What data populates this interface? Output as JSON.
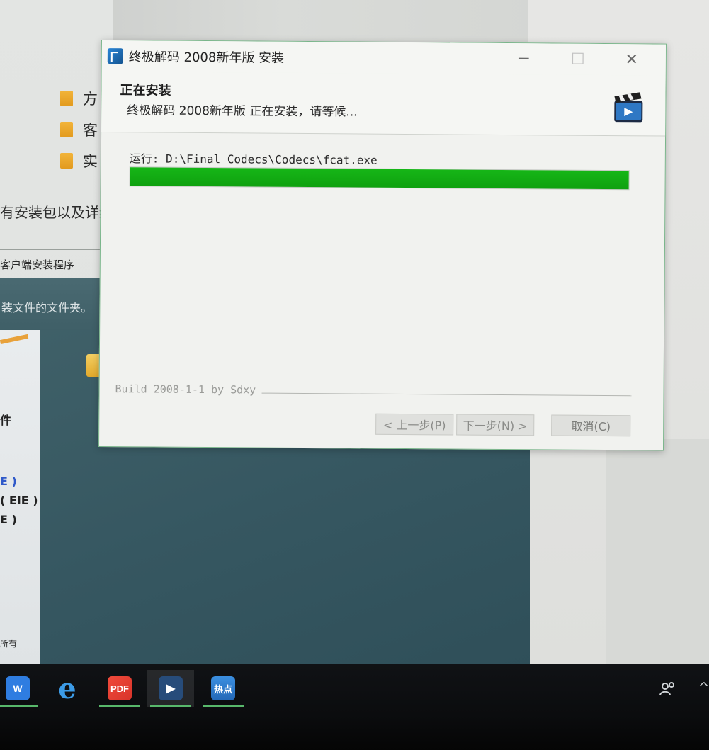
{
  "background": {
    "folders": [
      "方",
      "客",
      "实"
    ],
    "text_package": "有安装包以及详细",
    "text_client": "客户端安装程序",
    "text_folder": "装文件的文件夹。",
    "marks_blue": [
      "E )",
      "( EIE )"
    ],
    "marks_dark": [
      "E )",
      "件",
      "所有"
    ]
  },
  "dialog": {
    "title": "终极解码 2008新年版 安装",
    "minimize": "─",
    "maximize": "☐",
    "close": "✕",
    "header_title": "正在安装",
    "header_subtitle": "终极解码 2008新年版 正在安装，请等候...",
    "status_text": "运行: D:\\Final Codecs\\Codecs\\fcat.exe",
    "progress_fraction": 1.0,
    "build_text": "Build 2008-1-1 by Sdxy",
    "buttons": {
      "back": "< 上一步(P)",
      "next": "下一步(N) >",
      "cancel": "取消(C)"
    }
  },
  "taskbar": {
    "items": [
      {
        "name": "wps-writer",
        "label": "W"
      },
      {
        "name": "internet-explorer",
        "label": "e"
      },
      {
        "name": "pdf-reader",
        "label": "PDF"
      },
      {
        "name": "codec-installer",
        "label": "▶"
      },
      {
        "name": "hotspot-news",
        "label": "热点"
      }
    ],
    "tray_people_icon": "people-icon",
    "tray_chevron": "^"
  },
  "colors": {
    "progress": "#10a810",
    "accent_green": "#58b86b",
    "teal_desktop": "#365761"
  }
}
